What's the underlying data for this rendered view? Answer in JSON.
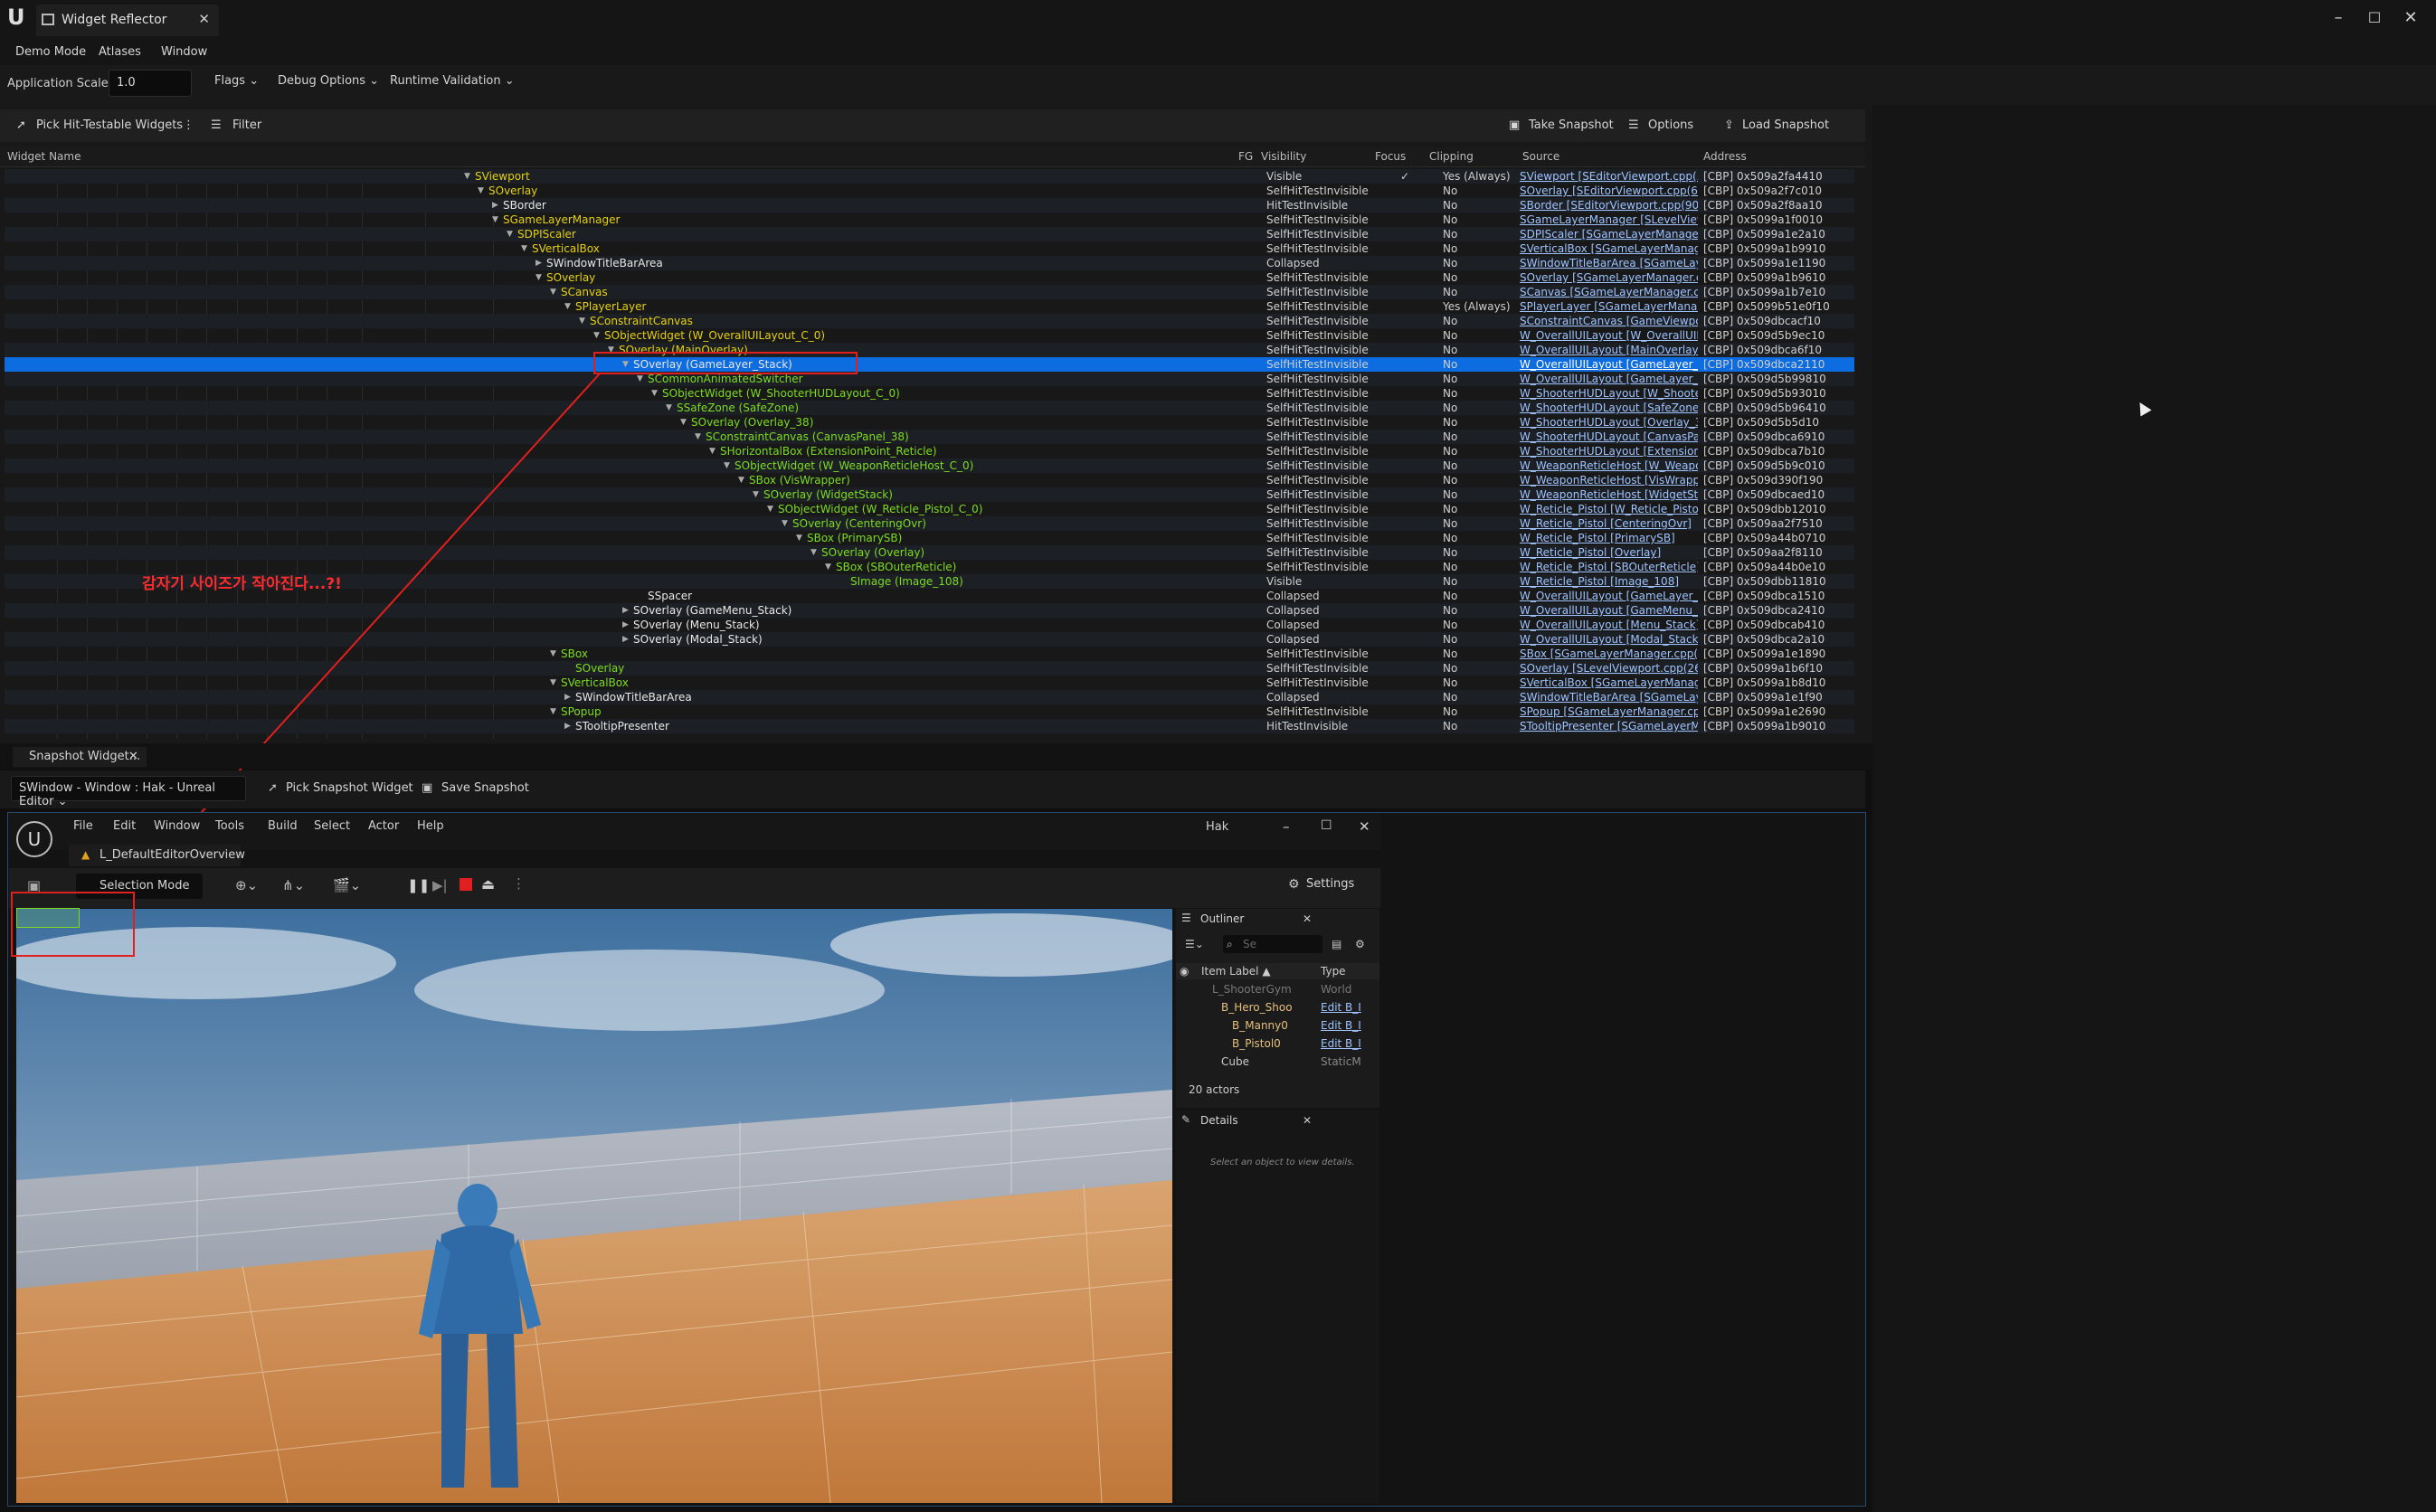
{
  "window": {
    "tab_title": "Widget Reflector",
    "controls": [
      "–",
      "☐",
      "✕"
    ]
  },
  "menu": [
    "Demo Mode",
    "Atlases",
    "Window"
  ],
  "toolbar": {
    "scale_label": "Application Scale:",
    "scale_value": "1.0",
    "flags": "Flags",
    "debug": "Debug Options",
    "runtime": "Runtime Validation"
  },
  "reflector_toolbar": {
    "pick": "Pick Hit-Testable Widgets",
    "filter": "Filter",
    "snapshot": "Take Snapshot",
    "options": "Options",
    "load": "Load Snapshot"
  },
  "columns": [
    "Widget Name",
    "FG",
    "Visibility",
    "Focus",
    "Clipping",
    "Source",
    "Address"
  ],
  "colors": {
    "green": "#7ddc1f",
    "yellow": "#e5d10d",
    "white": "#e8e8e8",
    "blue_select": "#0c6ce0",
    "red": "#e01f1f",
    "link": "#9ec3ff"
  },
  "tree": [
    {
      "name": "SViewport",
      "color": "yellow",
      "vis": "Visible",
      "focus": "✓",
      "clip": "Yes (Always)",
      "src": "SViewport [SEditorViewport.cpp(5(",
      "addr": "[CBP] 0x509a2fa4410"
    },
    {
      "name": "SOverlay",
      "color": "yellow",
      "vis": "SelfHitTestInvisible",
      "focus": "",
      "clip": "No",
      "src": "SOverlay [SEditorViewport.cpp(62",
      "addr": "[CBP] 0x509a2f7c010"
    },
    {
      "name": "SBorder",
      "color": "white",
      "vis": "HitTestInvisible",
      "focus": "",
      "clip": "No",
      "src": "SBorder [SEditorViewport.cpp(90)]",
      "addr": "[CBP] 0x509a2f8aa10"
    },
    {
      "name": "SGameLayerManager",
      "color": "yellow",
      "vis": "SelfHitTestInvisible",
      "focus": "",
      "clip": "No",
      "src": "SGameLayerManager [SLevelView",
      "addr": "[CBP] 0x5099a1f0010"
    },
    {
      "name": "SDPIScaler",
      "color": "yellow",
      "vis": "SelfHitTestInvisible",
      "focus": "",
      "clip": "No",
      "src": "SDPIScaler [SGameLayerManager",
      "addr": "[CBP] 0x5099a1e2a10"
    },
    {
      "name": "SVerticalBox",
      "color": "yellow",
      "vis": "SelfHitTestInvisible",
      "focus": "",
      "clip": "No",
      "src": "SVerticalBox [SGameLayerManag",
      "addr": "[CBP] 0x5099a1b9910"
    },
    {
      "name": "SWindowTitleBarArea",
      "color": "white",
      "vis": "Collapsed",
      "focus": "",
      "clip": "No",
      "src": "SWindowTitleBarArea [SGameLay",
      "addr": "[CBP] 0x5099a1e1190"
    },
    {
      "name": "SOverlay",
      "color": "yellow",
      "vis": "SelfHitTestInvisible",
      "focus": "",
      "clip": "No",
      "src": "SOverlay [SGameLayerManager.c",
      "addr": "[CBP] 0x5099a1b9610"
    },
    {
      "name": "SCanvas",
      "color": "yellow",
      "vis": "SelfHitTestInvisible",
      "focus": "",
      "clip": "No",
      "src": "SCanvas [SGameLayerManager.c",
      "addr": "[CBP] 0x5099a1b7e10"
    },
    {
      "name": "SPlayerLayer",
      "color": "yellow",
      "vis": "SelfHitTestInvisible",
      "focus": "",
      "clip": "Yes (Always)",
      "src": "SPlayerLayer [SGameLayerManac",
      "addr": "[CBP] 0x5099b51e0f10"
    },
    {
      "name": "SConstraintCanvas",
      "color": "yellow",
      "vis": "SelfHitTestInvisible",
      "focus": "",
      "clip": "No",
      "src": "SConstraintCanvas [GameViewpor",
      "addr": "[CBP] 0x509dbcacf10"
    },
    {
      "name": "SObjectWidget (W_OverallUILayout_C_0)",
      "color": "yellow",
      "vis": "SelfHitTestInvisible",
      "focus": "",
      "clip": "No",
      "src": "W_OverallUILayout [W_OverallUIL",
      "addr": "[CBP] 0x509d5b9ec10"
    },
    {
      "name": "SOverlay (MainOverlay)",
      "color": "yellow",
      "vis": "SelfHitTestInvisible",
      "focus": "",
      "clip": "No",
      "src": "W_OverallUILayout [MainOverlay]",
      "addr": "[CBP] 0x509dbca6f10"
    },
    {
      "name": "SOverlay (GameLayer_Stack)",
      "color": "yellow",
      "vis": "SelfHitTestInvisible",
      "focus": "",
      "clip": "No",
      "src": "W_OverallUILayout [GameLayer_S",
      "addr": "[CBP] 0x509dbca2110",
      "selected": true
    },
    {
      "name": "SCommonAnimatedSwitcher",
      "color": "green",
      "vis": "SelfHitTestInvisible",
      "focus": "",
      "clip": "No",
      "src": "W_OverallUILayout [GameLayer_S",
      "addr": "[CBP] 0x509d5b99810"
    },
    {
      "name": "SObjectWidget (W_ShooterHUDLayout_C_0)",
      "color": "green",
      "vis": "SelfHitTestInvisible",
      "focus": "",
      "clip": "No",
      "src": "W_ShooterHUDLayout [W_Shooter",
      "addr": "[CBP] 0x509d5b93010"
    },
    {
      "name": "SSafeZone (SafeZone)",
      "color": "green",
      "vis": "SelfHitTestInvisible",
      "focus": "",
      "clip": "No",
      "src": "W_ShooterHUDLayout [SafeZone]",
      "addr": "[CBP] 0x509d5b96410"
    },
    {
      "name": "SOverlay (Overlay_38)",
      "color": "green",
      "vis": "SelfHitTestInvisible",
      "focus": "",
      "clip": "No",
      "src": "W_ShooterHUDLayout [Overlay_38",
      "addr": "[CBP] 0x509d5b5d10"
    },
    {
      "name": "SConstraintCanvas (CanvasPanel_38)",
      "color": "green",
      "vis": "SelfHitTestInvisible",
      "focus": "",
      "clip": "No",
      "src": "W_ShooterHUDLayout [CanvasPar",
      "addr": "[CBP] 0x509dbca6910"
    },
    {
      "name": "SHorizontalBox (ExtensionPoint_Reticle)",
      "color": "green",
      "vis": "SelfHitTestInvisible",
      "focus": "",
      "clip": "No",
      "src": "W_ShooterHUDLayout [ExtensionP",
      "addr": "[CBP] 0x509dbca7b10"
    },
    {
      "name": "SObjectWidget (W_WeaponReticleHost_C_0)",
      "color": "green",
      "vis": "SelfHitTestInvisible",
      "focus": "",
      "clip": "No",
      "src": "W_WeaponReticleHost [W_Weapor",
      "addr": "[CBP] 0x509d5b9c010"
    },
    {
      "name": "SBox (VisWrapper)",
      "color": "green",
      "vis": "SelfHitTestInvisible",
      "focus": "",
      "clip": "No",
      "src": "W_WeaponReticleHost [VisWrappe",
      "addr": "[CBP] 0x509d390f190"
    },
    {
      "name": "SOverlay (WidgetStack)",
      "color": "green",
      "vis": "SelfHitTestInvisible",
      "focus": "",
      "clip": "No",
      "src": "W_WeaponReticleHost [WidgetSta",
      "addr": "[CBP] 0x509dbcaed10"
    },
    {
      "name": "SObjectWidget (W_Reticle_Pistol_C_0)",
      "color": "green",
      "vis": "SelfHitTestInvisible",
      "focus": "",
      "clip": "No",
      "src": "W_Reticle_Pistol [W_Reticle_Pistol",
      "addr": "[CBP] 0x509dbb12010"
    },
    {
      "name": "SOverlay (CenteringOvr)",
      "color": "green",
      "vis": "SelfHitTestInvisible",
      "focus": "",
      "clip": "No",
      "src": "W_Reticle_Pistol [CenteringOvr]",
      "addr": "[CBP] 0x509aa2f7510"
    },
    {
      "name": "SBox (PrimarySB)",
      "color": "green",
      "vis": "SelfHitTestInvisible",
      "focus": "",
      "clip": "No",
      "src": "W_Reticle_Pistol [PrimarySB]",
      "addr": "[CBP] 0x509a44b0710"
    },
    {
      "name": "SOverlay (Overlay)",
      "color": "green",
      "vis": "SelfHitTestInvisible",
      "focus": "",
      "clip": "No",
      "src": "W_Reticle_Pistol [Overlay]",
      "addr": "[CBP] 0x509aa2f8110"
    },
    {
      "name": "SBox (SBOuterReticle)",
      "color": "green",
      "vis": "SelfHitTestInvisible",
      "focus": "",
      "clip": "No",
      "src": "W_Reticle_Pistol [SBOuterReticle]",
      "addr": "[CBP] 0x509a44b0e10"
    },
    {
      "name": "SImage (Image_108)",
      "color": "green",
      "vis": "Visible",
      "focus": "",
      "clip": "No",
      "src": "W_Reticle_Pistol [Image_108]",
      "addr": "[CBP] 0x509dbb11810"
    },
    {
      "name": "SSpacer",
      "color": "white",
      "vis": "Collapsed",
      "focus": "",
      "clip": "No",
      "src": "W_OverallUILayout [GameLayer_S",
      "addr": "[CBP] 0x509dbca1510"
    },
    {
      "name": "SOverlay (GameMenu_Stack)",
      "color": "white",
      "vis": "Collapsed",
      "focus": "",
      "clip": "No",
      "src": "W_OverallUILayout [GameMenu_S",
      "addr": "[CBP] 0x509dbca2410"
    },
    {
      "name": "SOverlay (Menu_Stack)",
      "color": "white",
      "vis": "Collapsed",
      "focus": "",
      "clip": "No",
      "src": "W_OverallUILayout [Menu_Stack]",
      "addr": "[CBP] 0x509dbcab410"
    },
    {
      "name": "SOverlay (Modal_Stack)",
      "color": "white",
      "vis": "Collapsed",
      "focus": "",
      "clip": "No",
      "src": "W_OverallUILayout [Modal_Stack]",
      "addr": "[CBP] 0x509dbca2a10"
    },
    {
      "name": "SBox",
      "color": "green",
      "vis": "SelfHitTestInvisible",
      "focus": "",
      "clip": "No",
      "src": "SBox [SGameLayerManager.cpp(1",
      "addr": "[CBP] 0x5099a1e1890"
    },
    {
      "name": "SOverlay",
      "color": "green",
      "vis": "SelfHitTestInvisible",
      "focus": "",
      "clip": "No",
      "src": "SOverlay [SLevelViewport.cpp(26",
      "addr": "[CBP] 0x5099a1b6f10"
    },
    {
      "name": "SVerticalBox",
      "color": "green",
      "vis": "SelfHitTestInvisible",
      "focus": "",
      "clip": "No",
      "src": "SVerticalBox [SGameLayerManag",
      "addr": "[CBP] 0x5099a1b8d10"
    },
    {
      "name": "SWindowTitleBarArea",
      "color": "white",
      "vis": "Collapsed",
      "focus": "",
      "clip": "No",
      "src": "SWindowTitleBarArea [SGameLay",
      "addr": "[CBP] 0x5099a1e1f90"
    },
    {
      "name": "SPopup",
      "color": "green",
      "vis": "SelfHitTestInvisible",
      "focus": "",
      "clip": "No",
      "src": "SPopup [SGameLayerManager.cp",
      "addr": "[CBP] 0x5099a1e2690"
    },
    {
      "name": "STooltipPresenter",
      "color": "white",
      "vis": "HitTestInvisible",
      "focus": "",
      "clip": "No",
      "src": "STooltipPresenter [SGameLayerM",
      "addr": "[CBP] 0x5099a1b9010"
    }
  ],
  "annotation": "감자기 사이즈가 작아진다...?!",
  "snapshot_tab": "Snapshot Widget...",
  "snapshot_toolbar": {
    "window_select": "SWindow - Window : Hak - Unreal Editor",
    "pick": "Pick Snapshot Widget",
    "save": "Save Snapshot"
  },
  "editor": {
    "menu": [
      "File",
      "Edit",
      "Window",
      "Tools",
      "Build",
      "Select",
      "Actor",
      "Help"
    ],
    "project": "Hak",
    "level": "L_DefaultEditorOverview",
    "mode": "Selection Mode",
    "settings": "Settings",
    "outliner_title": "Outliner",
    "search_placeholder": "Se",
    "col_label": "Item Label ▲",
    "col_type": "Type",
    "items": [
      {
        "label": "L_ShooterGym",
        "type": "World"
      },
      {
        "label": "B_Hero_Shoo",
        "type": "Edit B_I"
      },
      {
        "label": "B_Manny0",
        "type": "Edit B_I"
      },
      {
        "label": "B_Pistol0",
        "type": "Edit B_I"
      },
      {
        "label": "Cube",
        "type": "StaticM"
      }
    ],
    "actor_count": "20 actors",
    "details_title": "Details",
    "details_empty": "Select an object to view details."
  }
}
